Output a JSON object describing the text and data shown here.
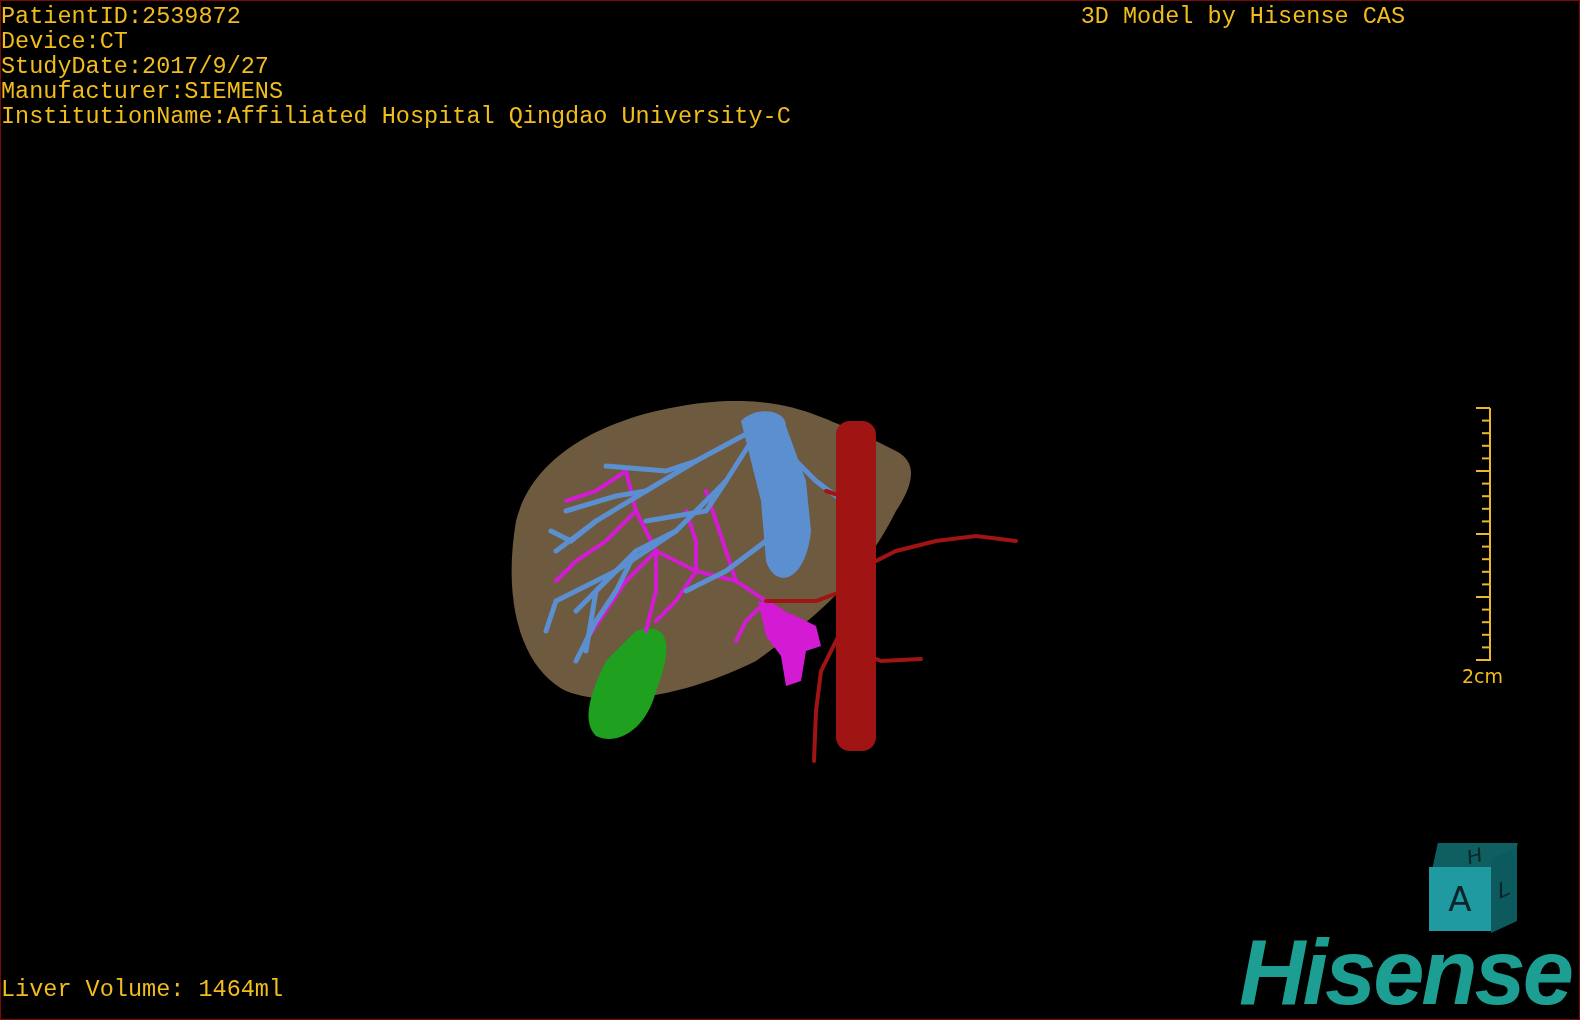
{
  "study_info": [
    "PatientID:2539872",
    "Device:CT",
    "StudyDate:2017/9/27",
    "Manufacturer:SIEMENS",
    "InstitutionName:Affiliated Hospital Qingdao University-C"
  ],
  "title": "3D Model by Hisense CAS",
  "scale_bar": {
    "label": "2cm"
  },
  "orientation_cube": {
    "front": "A",
    "top": "H",
    "side": "L"
  },
  "logo": "Hisense",
  "liver_volume": "Liver Volume: 1464ml"
}
